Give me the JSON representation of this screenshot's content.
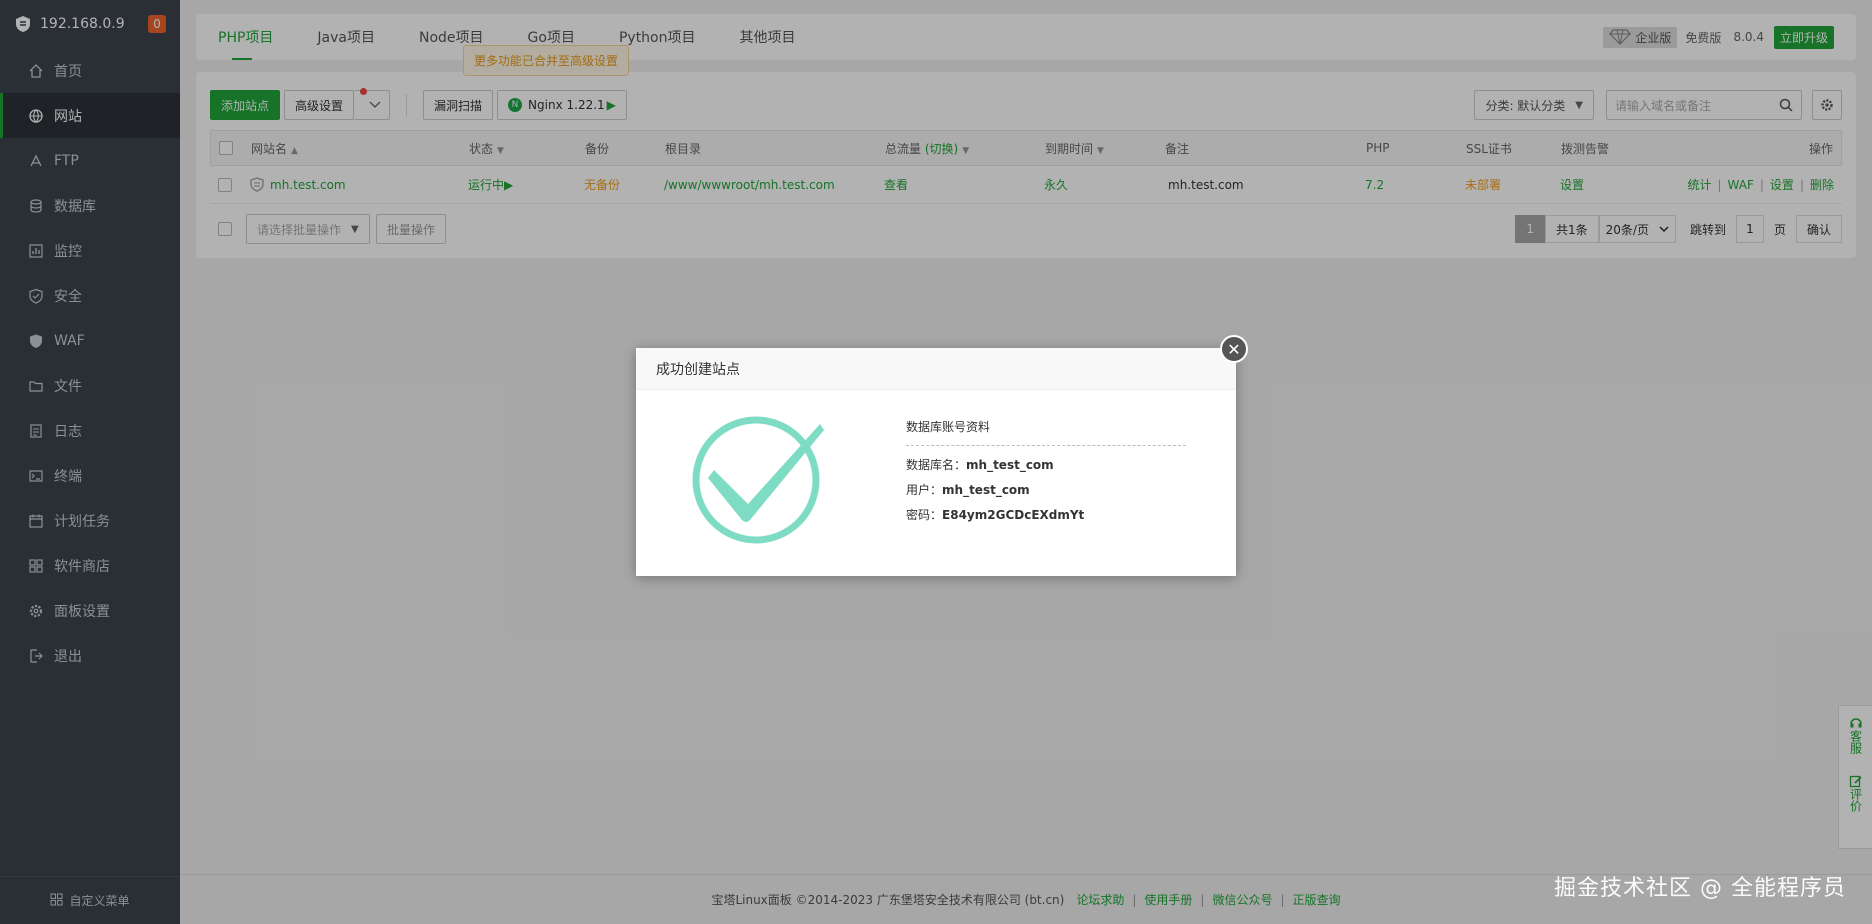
{
  "sidebar": {
    "ip": "192.168.0.9",
    "badge": "0",
    "items": [
      {
        "label": "首页",
        "icon": "home-icon"
      },
      {
        "label": "网站",
        "icon": "globe-icon"
      },
      {
        "label": "FTP",
        "icon": "ftp-icon"
      },
      {
        "label": "数据库",
        "icon": "database-icon"
      },
      {
        "label": "监控",
        "icon": "monitor-icon"
      },
      {
        "label": "安全",
        "icon": "shield-icon"
      },
      {
        "label": "WAF",
        "icon": "waf-icon"
      },
      {
        "label": "文件",
        "icon": "folder-icon"
      },
      {
        "label": "日志",
        "icon": "log-icon"
      },
      {
        "label": "终端",
        "icon": "terminal-icon"
      },
      {
        "label": "计划任务",
        "icon": "calendar-icon"
      },
      {
        "label": "软件商店",
        "icon": "grid-icon"
      },
      {
        "label": "面板设置",
        "icon": "gear-icon"
      },
      {
        "label": "退出",
        "icon": "logout-icon"
      }
    ],
    "custom_menu": "自定义菜单"
  },
  "topbar": {
    "tabs": [
      "PHP项目",
      "Java项目",
      "Node项目",
      "Go项目",
      "Python项目",
      "其他项目"
    ],
    "enterprise": "企业版",
    "free": "免费版",
    "version": "8.0.4",
    "upgrade": "立即升级"
  },
  "tooltip": "更多功能已合并至高级设置",
  "toolbar": {
    "add_site": "添加站点",
    "advanced": "高级设置",
    "vuln_scan": "漏洞扫描",
    "nginx": "Nginx 1.22.1",
    "category": "分类: 默认分类",
    "search_placeholder": "请输入域名或备注"
  },
  "table": {
    "headers": {
      "name": "网站名",
      "status": "状态",
      "backup": "备份",
      "root": "根目录",
      "traffic": "总流量",
      "traffic_switch": "(切换)",
      "expire": "到期时间",
      "remark": "备注",
      "php": "PHP",
      "ssl": "SSL证书",
      "alarm": "拨测告警",
      "ops": "操作"
    },
    "rows": [
      {
        "name": "mh.test.com",
        "status": "运行中",
        "backup": "无备份",
        "root": "/www/wwwroot/mh.test.com",
        "traffic": "查看",
        "expire": "永久",
        "remark": "mh.test.com",
        "php": "7.2",
        "ssl": "未部署",
        "alarm": "设置",
        "ops": [
          "统计",
          "WAF",
          "设置",
          "删除"
        ]
      }
    ]
  },
  "batch": {
    "select_placeholder": "请选择批量操作",
    "button": "批量操作"
  },
  "pager": {
    "current": "1",
    "total": "共1条",
    "per_page": "20条/页",
    "jump_label": "跳转到",
    "jump_value": "1",
    "unit": "页",
    "confirm": "确认"
  },
  "footer": {
    "copyright": "宝塔Linux面板 ©2014-2023 广东堡塔安全技术有限公司 (bt.cn)",
    "links": [
      "论坛求助",
      "使用手册",
      "微信公众号",
      "正版查询"
    ]
  },
  "float_tools": {
    "service": "客服",
    "review": "评价"
  },
  "modal": {
    "title": "成功创建站点",
    "db_title": "数据库账号资料",
    "db_name_label": "数据库名：",
    "db_name": "mh_test_com",
    "user_label": "用户：",
    "user": "mh_test_com",
    "password_label": "密码：",
    "password": "E84ym2GCDcEXdmYt"
  },
  "watermark": "掘金技术社区 @ 全能程序员",
  "colors": {
    "accent": "#20a53a",
    "sidebar": "#3c444d",
    "warning": "#f0a020",
    "check": "#7fdcc4"
  }
}
